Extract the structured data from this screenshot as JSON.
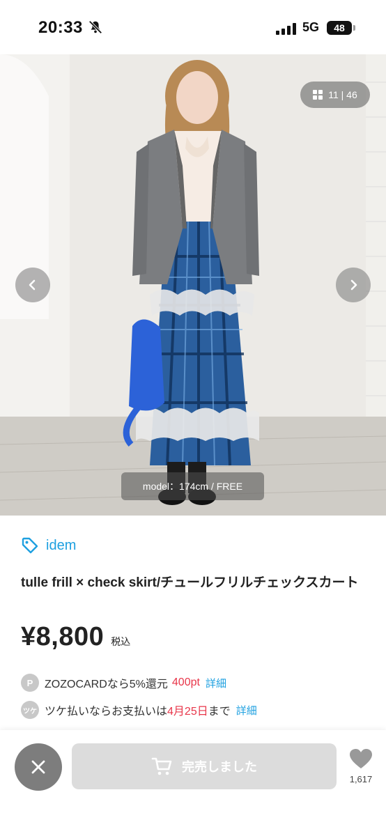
{
  "status_bar": {
    "time": "20:33",
    "network": "5G",
    "battery": "48"
  },
  "gallery": {
    "counter": "11 | 46",
    "model_info": "model：174cm / FREE"
  },
  "product": {
    "brand": "idem",
    "title": "tulle frill × check skirt/チュールフリルチェックスカート",
    "price": "¥8,800",
    "tax_label": "税込"
  },
  "benefits": {
    "zozocard": {
      "icon": "P",
      "text": "ZOZOCARDなら5%還元",
      "points": "400pt",
      "link": "詳細"
    },
    "tsuke": {
      "icon": "ツケ",
      "text_before": "ツケ払いならお支払いは",
      "date": "4月25日",
      "text_after": "まで",
      "link": "詳細"
    }
  },
  "bottom_bar": {
    "sold_out_label": "完売しました",
    "favorite_count": "1,617"
  },
  "colors": {
    "accent_blue": "#1ea0e0",
    "accent_red": "#e8364a",
    "disabled_gray": "#dcdcdc"
  }
}
